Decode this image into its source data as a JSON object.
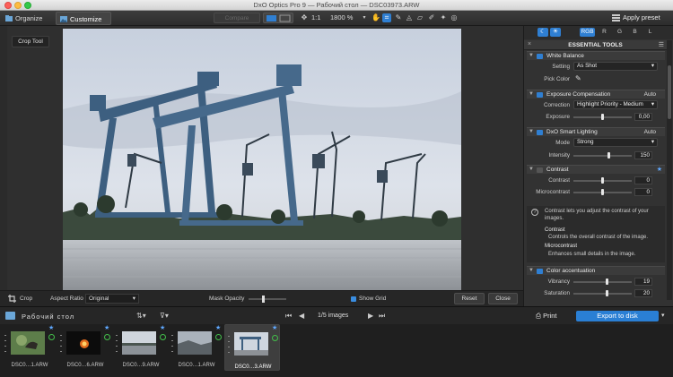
{
  "window": {
    "title": "DxO Optics Pro 9 — Рабочий стол — DSC03973.ARW"
  },
  "toolbar": {
    "tab_organize": "Organize",
    "tab_customize": "Customize",
    "compare_label": "Compare",
    "zoom_fit": "1:1",
    "zoom_value": "1800 %",
    "apply_preset": "Apply preset"
  },
  "viewer": {
    "crop_tool_label": "Crop Tool"
  },
  "cropbar": {
    "crop_label": "Crop",
    "aspect_ratio_label": "Aspect Ratio",
    "aspect_ratio_value": "Original",
    "mask_opacity_label": "Mask Opacity",
    "show_grid_label": "Show Grid",
    "reset_label": "Reset",
    "close_label": "Close"
  },
  "right_panel": {
    "channels": [
      "RGB",
      "R",
      "G",
      "B",
      "L"
    ],
    "panel_title": "ESSENTIAL TOOLS",
    "white_balance": {
      "title": "White Balance",
      "setting_label": "Setting",
      "setting_value": "As Shot",
      "pick_color_label": "Pick Color"
    },
    "exposure": {
      "title": "Exposure Compensation",
      "auto": "Auto",
      "correction_label": "Correction",
      "correction_value": "Highlight Priority - Medium",
      "exposure_label": "Exposure",
      "exposure_value": "0,00",
      "exposure_level": 0.5
    },
    "smart_lighting": {
      "title": "DxO Smart Lighting",
      "auto": "Auto",
      "mode_label": "Mode",
      "mode_value": "Strong",
      "intensity_label": "Intensity",
      "intensity_value": "150",
      "intensity_level": 0.6
    },
    "contrast": {
      "title": "Contrast",
      "contrast_label": "Contrast",
      "contrast_value": "0",
      "contrast_level": 0.5,
      "microcontrast_label": "Microcontrast",
      "microcontrast_value": "0",
      "microcontrast_level": 0.5
    },
    "help": {
      "intro": "Contrast lets you adjust the contrast of your images.",
      "contrast_title": "Contrast",
      "contrast_desc": "Controls the overall contrast of the image.",
      "micro_title": "Microcontrast",
      "micro_desc": "Enhances small details in the image."
    },
    "color_accentuation": {
      "title": "Color accentuation",
      "vibrancy_label": "Vibrancy",
      "vibrancy_value": "19",
      "vibrancy_level": 0.57,
      "saturation_label": "Saturation",
      "saturation_value": "20",
      "saturation_level": 0.58
    }
  },
  "filmstrip_bar": {
    "folder_title": "Рабочий стол",
    "pager_text": "1/5 images",
    "print_label": "Print",
    "export_label": "Export to disk"
  },
  "filmstrip": [
    {
      "name": "DSC0…1.ARW"
    },
    {
      "name": "DSC0…6.ARW"
    },
    {
      "name": "DSC0…9.ARW"
    },
    {
      "name": "DSC0…1.ARW"
    },
    {
      "name": "DSC0…3.ARW"
    }
  ]
}
